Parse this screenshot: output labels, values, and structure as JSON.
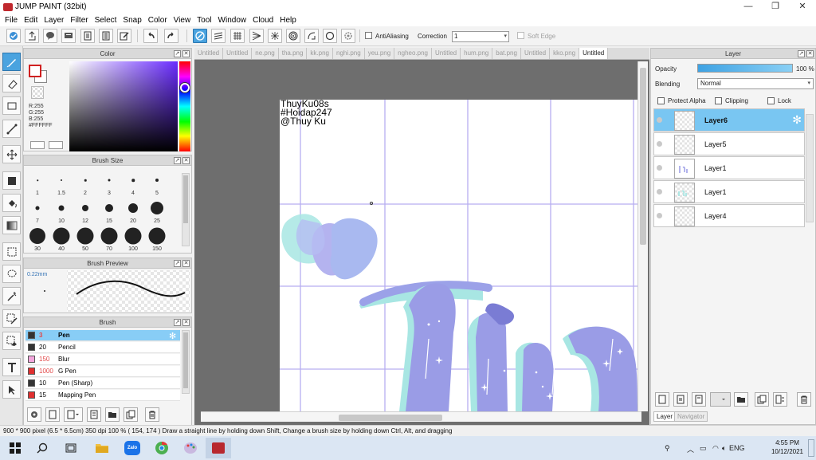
{
  "window": {
    "title": "JUMP PAINT (32bit)",
    "minimize": "—",
    "maximize": "❐",
    "close": "✕"
  },
  "menu": [
    "File",
    "Edit",
    "Layer",
    "Filter",
    "Select",
    "Snap",
    "Color",
    "View",
    "Tool",
    "Window",
    "Cloud",
    "Help"
  ],
  "toolbar": {
    "antialiasing_label": "AntiAliasing",
    "correction_label": "Correction",
    "correction_value": "1",
    "soft_edge_label": "Soft Edge"
  },
  "color_panel": {
    "title": "Color",
    "rgb": [
      "R:255",
      "G:255",
      "B:255"
    ],
    "hex": "#FFFFFF",
    "foreground": "#ffffff"
  },
  "brush_size_panel": {
    "title": "Brush Size",
    "sizes": [
      "1",
      "1.5",
      "2",
      "3",
      "4",
      "5",
      "7",
      "10",
      "12",
      "15",
      "20",
      "25",
      "30",
      "40",
      "50",
      "70",
      "100",
      "150"
    ]
  },
  "brush_preview_panel": {
    "title": "Brush Preview",
    "size": "0.22mm"
  },
  "brush_panel": {
    "title": "Brush",
    "brushes": [
      {
        "size": "3",
        "name": "Pen",
        "color": "#333333",
        "size_color": "#e24a4a"
      },
      {
        "size": "20",
        "name": "Pencil",
        "color": "#333333",
        "size_color": "#000000"
      },
      {
        "size": "150",
        "name": "Blur",
        "color": "#f3a6dd",
        "size_color": "#e24a4a"
      },
      {
        "size": "1000",
        "name": "G Pen",
        "color": "#e03030",
        "size_color": "#e24a4a"
      },
      {
        "size": "10",
        "name": "Pen (Sharp)",
        "color": "#333333",
        "size_color": "#000000"
      },
      {
        "size": "15",
        "name": "Mapping Pen",
        "color": "#e03030",
        "size_color": "#000000"
      }
    ]
  },
  "doc_tabs": [
    "Untitled",
    "Untitled",
    "ne.png",
    "tha.png",
    "kk.png",
    "nghi.png",
    "yeu.png",
    "ngheo.png",
    "Untitled",
    "hum.png",
    "bat.png",
    "Untitled",
    "kko.png",
    "Untitled"
  ],
  "canvas": {
    "watermark": [
      "ThuyKu08s",
      "#Hoidap247",
      "@Thuy Ku"
    ]
  },
  "layer_panel": {
    "title": "Layer",
    "opacity_label": "Opacity",
    "opacity_value": "100 %",
    "blending_label": "Blending",
    "blending_value": "Normal",
    "protect_alpha": "Protect Alpha",
    "clipping": "Clipping",
    "lock": "Lock",
    "layers": [
      "Layer6",
      "Layer5",
      "Layer1",
      "Layer1",
      "Layer4"
    ],
    "tabs": [
      "Layer",
      "Navigator"
    ]
  },
  "status": "900 * 900 pixel   (6.5 * 6.5cm)   350 dpi   100 %   ( 154, 174 )   Draw a straight line by holding down Shift, Change a brush size by holding down Ctrl, Alt, and dragging",
  "taskbar": {
    "time": "4:55 PM",
    "date": "10/12/2021",
    "lang": "ENG",
    "zalo": "Zalo"
  }
}
